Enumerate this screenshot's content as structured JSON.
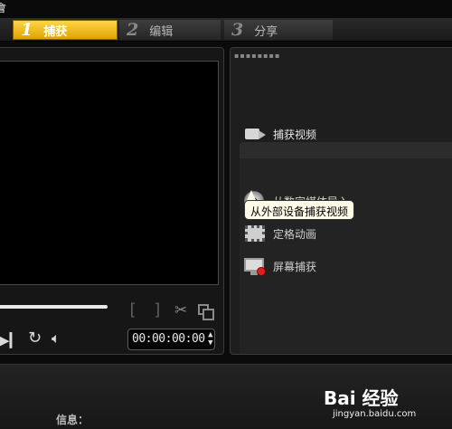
{
  "window": {
    "title": "會"
  },
  "tabs": [
    {
      "num": "1",
      "label": "捕获",
      "active": true
    },
    {
      "num": "2",
      "label": "编辑",
      "active": false
    },
    {
      "num": "3",
      "label": "分享",
      "active": false
    }
  ],
  "player": {
    "mark_in": "[",
    "mark_out": "]",
    "timecode": "00:00:00:00",
    "scrub_progress": 0.5
  },
  "options": {
    "items": [
      {
        "label": "捕获视频",
        "icon": "video-camera-icon"
      },
      {
        "label": "从数字媒体导入",
        "icon": "disc-import-icon"
      },
      {
        "label": "定格动画",
        "icon": "film-frame-icon"
      },
      {
        "label": "屏幕捕获",
        "icon": "screen-record-icon"
      }
    ],
    "tooltip": "从外部设备捕获视频"
  },
  "info": {
    "label": "信息："
  },
  "watermark": {
    "logo": "Bai 经验",
    "url": "jingyan.baidu.com"
  },
  "colors": {
    "active_tab": "#f2b400",
    "panel": "#1e1e1e",
    "preview": "#000000"
  }
}
